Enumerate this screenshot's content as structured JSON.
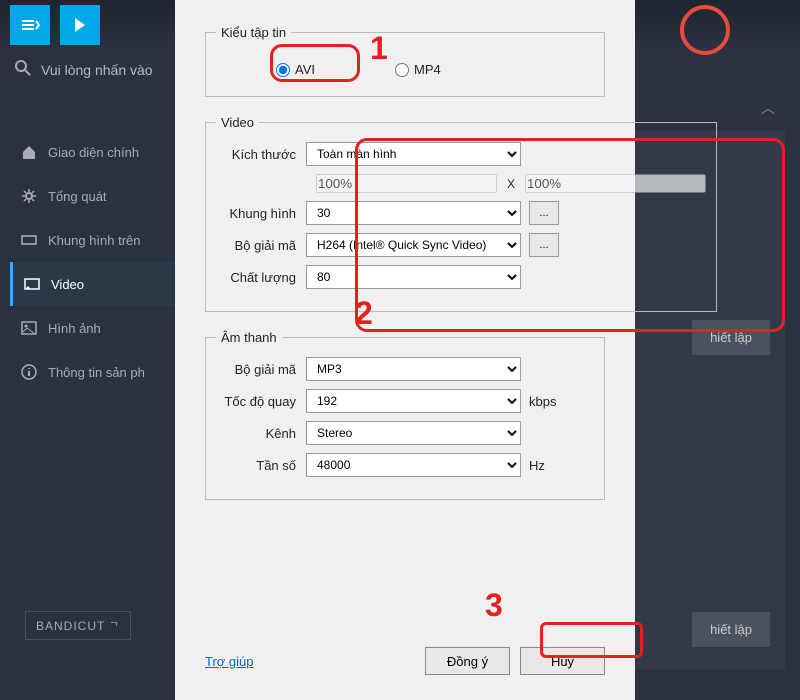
{
  "background": {
    "search_text": "Vui lòng nhấn vào",
    "sidebar": [
      {
        "icon": "home",
        "label": "Giao diện chính"
      },
      {
        "icon": "gear",
        "label": "Tổng quát"
      },
      {
        "icon": "frame",
        "label": "Khung hình trên"
      },
      {
        "icon": "video",
        "label": "Video"
      },
      {
        "icon": "image",
        "label": "Hình ảnh"
      },
      {
        "icon": "info",
        "label": "Thông tin sản ph"
      }
    ],
    "bg_button": "hiết lập",
    "bandicut": "BANDICUT"
  },
  "dialog": {
    "file_type": {
      "legend": "Kiểu tập tin",
      "options": [
        "AVI",
        "MP4"
      ],
      "selected": "AVI"
    },
    "video": {
      "legend": "Video",
      "size_label": "Kích thước",
      "size_value": "Toàn màn hình",
      "scale_w": "100%",
      "scale_h": "100%",
      "scale_x": "X",
      "fps_label": "Khung hình",
      "fps_value": "30",
      "codec_label": "Bộ giải mã",
      "codec_value": "H264 (Intel® Quick Sync Video)",
      "quality_label": "Chất lượng",
      "quality_value": "80",
      "dots": "..."
    },
    "audio": {
      "legend": "Âm thanh",
      "codec_label": "Bộ giải mã",
      "codec_value": "MP3",
      "bitrate_label": "Tốc độ quay",
      "bitrate_value": "192",
      "bitrate_unit": "kbps",
      "channel_label": "Kênh",
      "channel_value": "Stereo",
      "freq_label": "Tần số",
      "freq_value": "48000",
      "freq_unit": "Hz"
    },
    "footer": {
      "help": "Trợ giúp",
      "ok": "Đồng ý",
      "cancel": "Hủy"
    }
  },
  "annotations": {
    "n1": "1",
    "n2": "2",
    "n3": "3"
  }
}
